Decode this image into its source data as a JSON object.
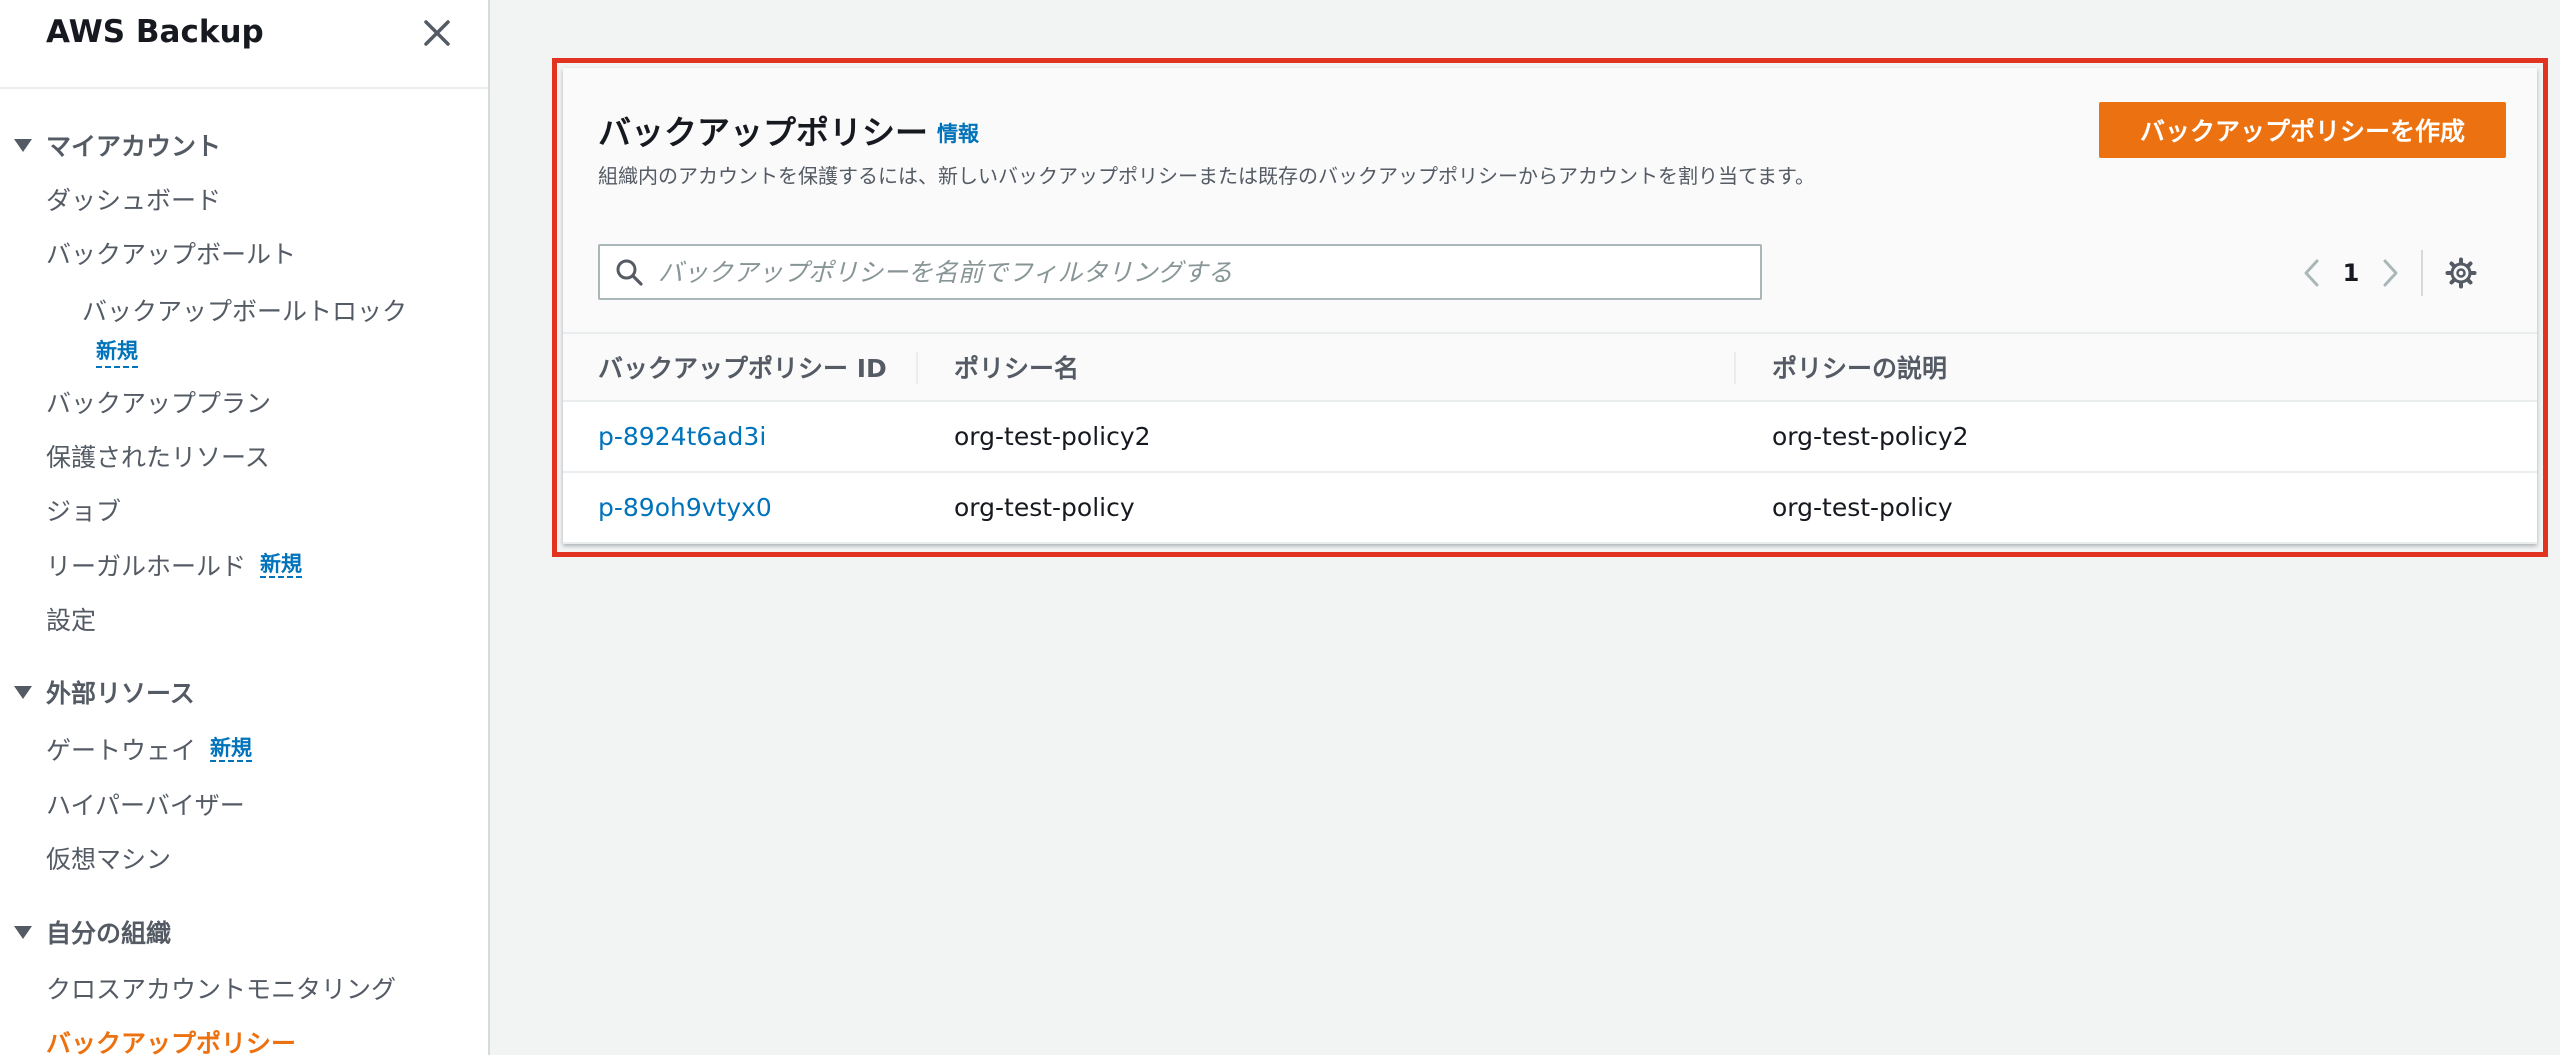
{
  "sidebar": {
    "title": "AWS Backup",
    "sections": [
      {
        "label": "マイアカウント",
        "items": [
          {
            "label": "ダッシュボード"
          },
          {
            "label": "バックアップボールト"
          },
          {
            "label": "バックアップボールトロック",
            "badge": "新規"
          },
          {
            "label": "バックアッププラン"
          },
          {
            "label": "保護されたリソース"
          },
          {
            "label": "ジョブ"
          },
          {
            "label": "リーガルホールド",
            "badge": "新規"
          },
          {
            "label": "設定"
          }
        ]
      },
      {
        "label": "外部リソース",
        "items": [
          {
            "label": "ゲートウェイ",
            "badge": "新規"
          },
          {
            "label": "ハイパーバイザー"
          },
          {
            "label": "仮想マシン"
          }
        ]
      },
      {
        "label": "自分の組織",
        "items": [
          {
            "label": "クロスアカウントモニタリング"
          },
          {
            "label": "バックアップポリシー",
            "active": true
          }
        ]
      }
    ]
  },
  "panel": {
    "title": "バックアップポリシー",
    "info_label": "情報",
    "description": "組織内のアカウントを保護するには、新しいバックアップポリシーまたは既存のバックアップポリシーからアカウントを割り当てます。",
    "create_button": "バックアップポリシーを作成",
    "search": {
      "placeholder": "バックアップポリシーを名前でフィルタリングする",
      "value": ""
    },
    "pagination": {
      "current_page": "1"
    },
    "table": {
      "columns": [
        "バックアップポリシー ID",
        "ポリシー名",
        "ポリシーの説明"
      ],
      "rows": [
        [
          "p-8924t6ad3i",
          "org-test-policy2",
          "org-test-policy2"
        ],
        [
          "p-89oh9vtyx0",
          "org-test-policy",
          "org-test-policy"
        ]
      ]
    }
  },
  "colors": {
    "accent": "#ec7211",
    "link": "#0073bb",
    "highlight_border": "#e1331f",
    "background": "#f2f3f3"
  },
  "icons": {
    "close": "close-icon",
    "search": "search-icon",
    "prev": "chevron-left-icon",
    "next": "chevron-right-icon",
    "settings": "gear-icon",
    "section_toggle": "caret-down-icon"
  }
}
